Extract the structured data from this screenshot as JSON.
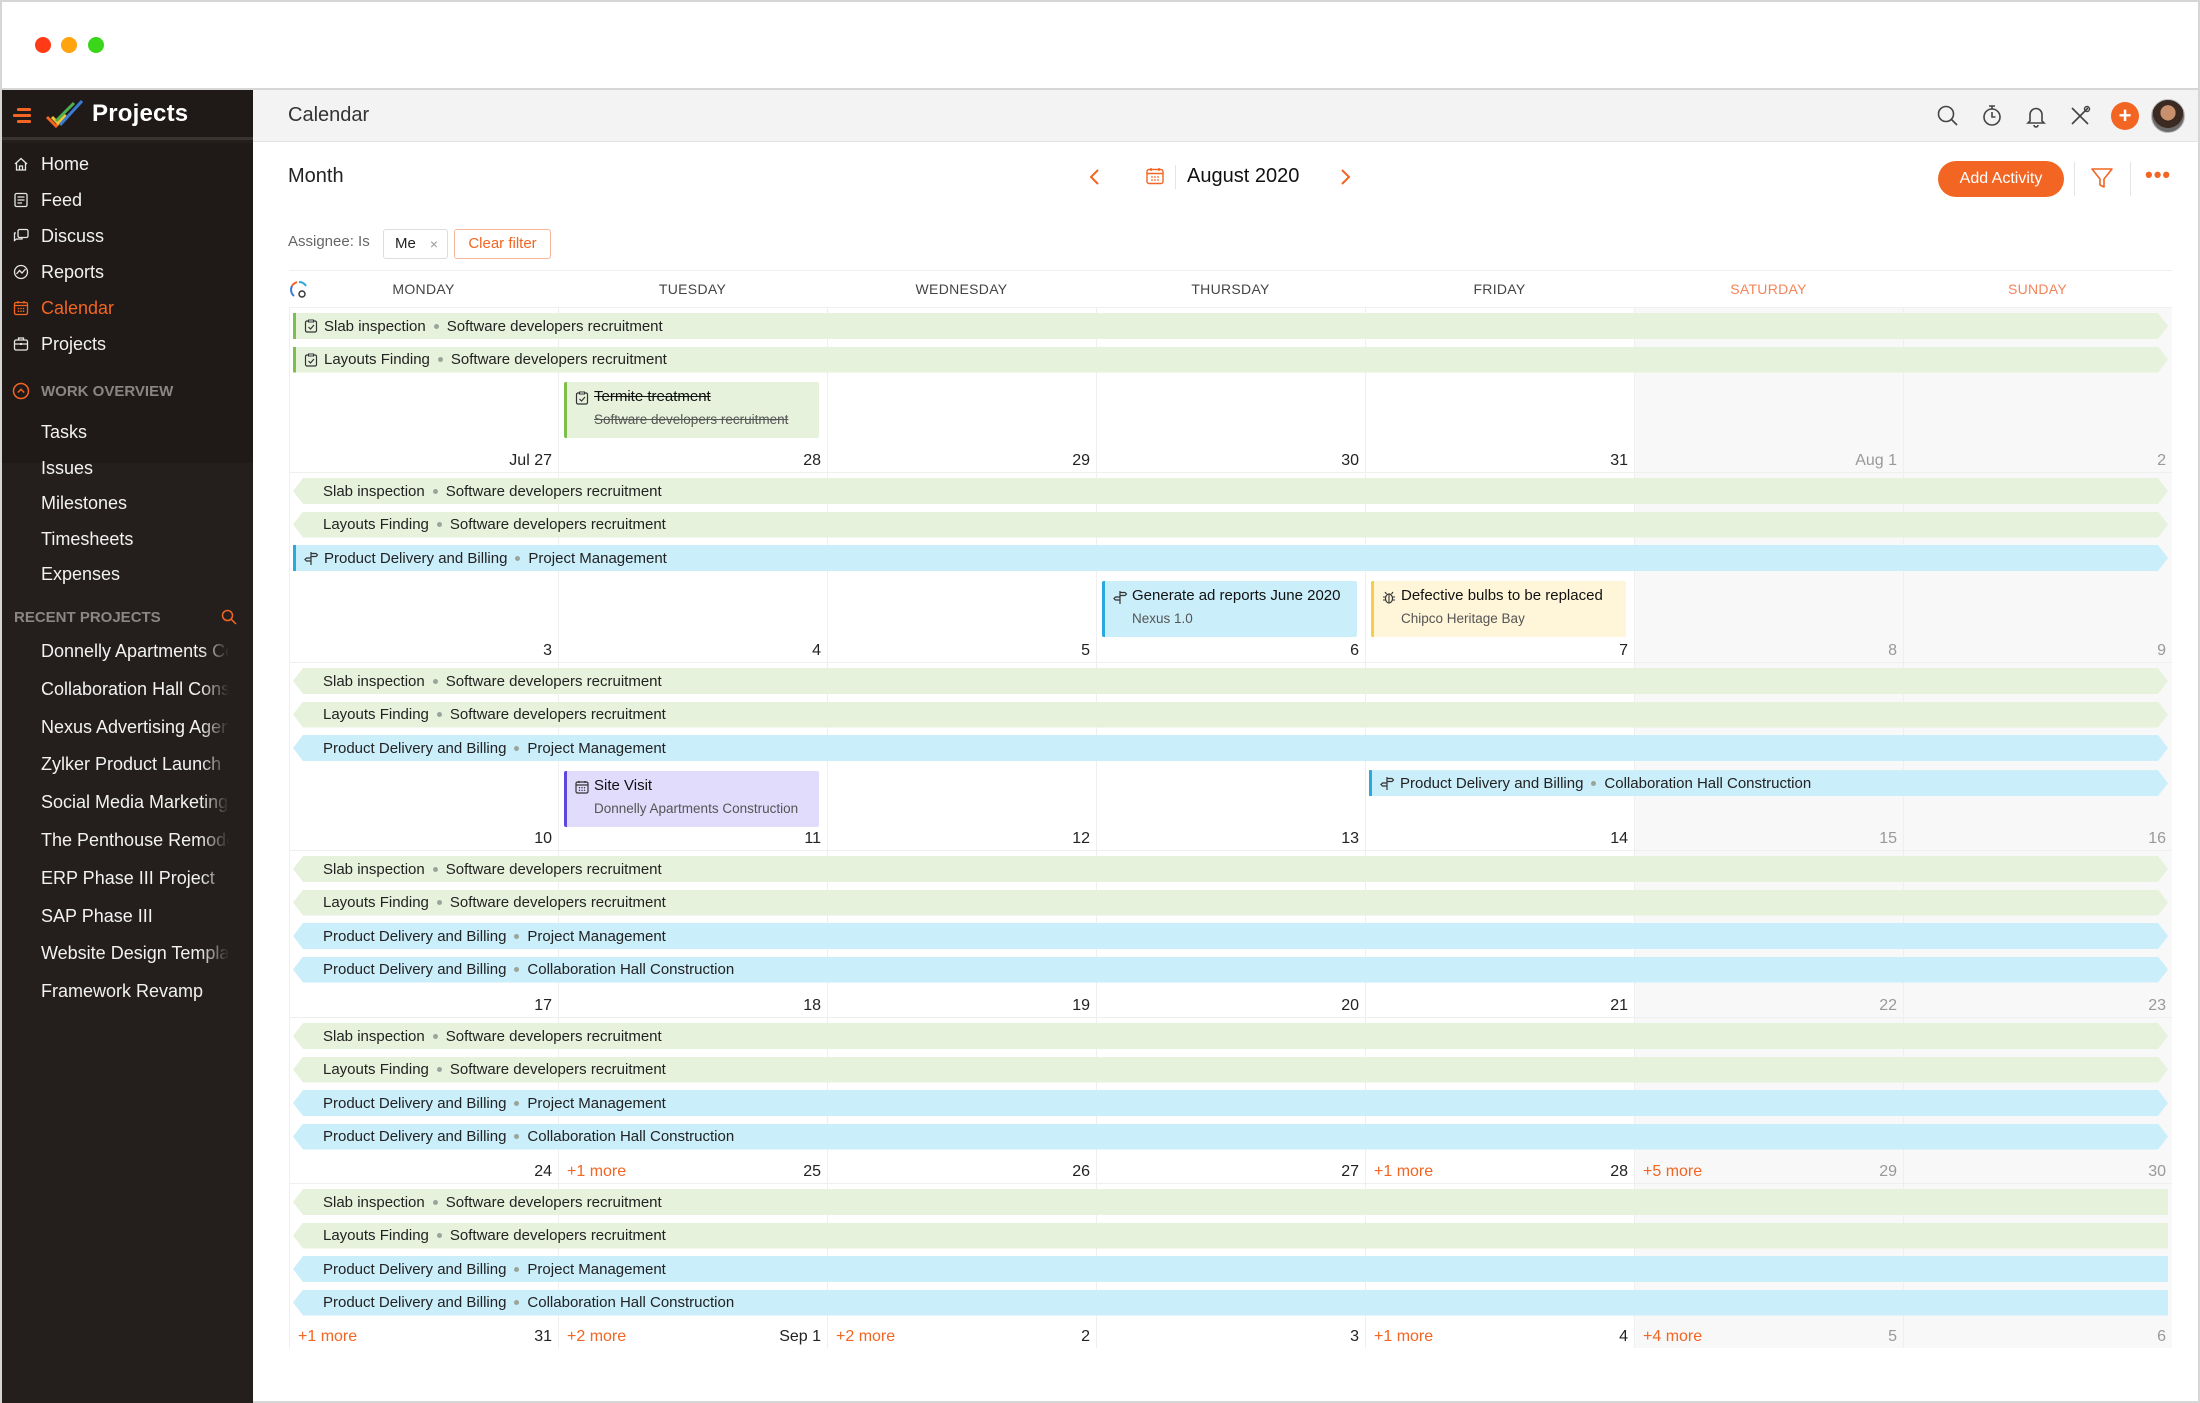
{
  "app": {
    "name": "Projects"
  },
  "sidebar": {
    "nav": [
      {
        "label": "Home",
        "icon": "home-icon",
        "active": false
      },
      {
        "label": "Feed",
        "icon": "feed-icon",
        "active": false
      },
      {
        "label": "Discuss",
        "icon": "discuss-icon",
        "active": false
      },
      {
        "label": "Reports",
        "icon": "reports-icon",
        "active": false
      },
      {
        "label": "Calendar",
        "icon": "calendar-icon",
        "active": true
      },
      {
        "label": "Projects",
        "icon": "briefcase-icon",
        "active": false
      }
    ],
    "work_overview": {
      "title": "WORK OVERVIEW",
      "items": [
        "Tasks",
        "Issues",
        "Milestones",
        "Timesheets",
        "Expenses"
      ]
    },
    "recent_projects": {
      "title": "RECENT PROJECTS",
      "items": [
        "Donnelly Apartments Construction",
        "Collaboration Hall Construction",
        "Nexus Advertising Agency",
        "Zylker Product Launch",
        "Social Media Marketing",
        "The Penthouse Remodel",
        "ERP Phase III Project",
        "SAP Phase III",
        "Website Design Template",
        "Framework Revamp"
      ]
    }
  },
  "topbar": {
    "title": "Calendar",
    "icons": [
      "search-icon",
      "timer-icon",
      "bell-icon",
      "tools-icon",
      "plus-icon",
      "avatar"
    ],
    "plus_label": "+"
  },
  "toolbar": {
    "view": "Month",
    "month_label": "August 2020",
    "add_activity": "Add Activity",
    "more": "•••"
  },
  "filter": {
    "label": "Assignee: Is",
    "chip": "Me",
    "chip_remove": "×",
    "clear": "Clear filter"
  },
  "colors": {
    "accent": "#f26522",
    "task_bg": "#e7f2dc",
    "task_border": "#7cc04b",
    "milestone_bg": "#cbeefb",
    "milestone_border": "#2aa8e0",
    "issue_bg": "#fff5d8",
    "issue_border": "#f7cd46",
    "event_bg": "#e1dcfb",
    "event_border": "#5b47e0",
    "sidebar_bg": "#241f1d"
  },
  "calendar": {
    "days": [
      {
        "name": "MONDAY",
        "weekend": false
      },
      {
        "name": "TUESDAY",
        "weekend": false
      },
      {
        "name": "WEDNESDAY",
        "weekend": false
      },
      {
        "name": "THURSDAY",
        "weekend": false
      },
      {
        "name": "FRIDAY",
        "weekend": false
      },
      {
        "name": "SATURDAY",
        "weekend": true
      },
      {
        "name": "SUNDAY",
        "weekend": true
      }
    ],
    "weeks": [
      {
        "dates": [
          "Jul 27",
          "28",
          "29",
          "30",
          "31",
          "Aug 1",
          "2"
        ],
        "dim": [
          false,
          false,
          false,
          false,
          false,
          true,
          true
        ],
        "more": [
          null,
          null,
          null,
          null,
          null,
          null,
          null
        ],
        "bars": [
          {
            "title": "Slab inspection",
            "project": "Software developers recruitment",
            "type": "task",
            "color": "green",
            "start": 0,
            "end": 6,
            "starts_here": true,
            "continues_right": true,
            "icon": "task-icon"
          },
          {
            "title": "Layouts Finding",
            "project": "Software developers recruitment",
            "type": "task",
            "color": "green",
            "start": 0,
            "end": 6,
            "starts_here": true,
            "continues_right": true,
            "icon": "task-icon"
          }
        ],
        "cards": [
          {
            "title": "Termite treatment",
            "subtitle": "Software developers recruitment",
            "type": "task",
            "color": "green",
            "col": 1,
            "done": true,
            "icon": "task-icon"
          }
        ]
      },
      {
        "dates": [
          "3",
          "4",
          "5",
          "6",
          "7",
          "8",
          "9"
        ],
        "dim": [
          false,
          false,
          false,
          false,
          false,
          true,
          true
        ],
        "more": [
          null,
          null,
          null,
          null,
          null,
          null,
          null
        ],
        "bars": [
          {
            "title": "Slab inspection",
            "project": "Software developers recruitment",
            "type": "task",
            "color": "green",
            "start": 0,
            "end": 6,
            "starts_here": false,
            "continues_right": true
          },
          {
            "title": "Layouts Finding",
            "project": "Software developers recruitment",
            "type": "task",
            "color": "green",
            "start": 0,
            "end": 6,
            "starts_here": false,
            "continues_right": true
          },
          {
            "title": "Product Delivery and Billing",
            "project": "Project Management",
            "type": "milestone",
            "color": "blue",
            "start": 0,
            "end": 6,
            "starts_here": true,
            "continues_right": true,
            "icon": "milestone-icon"
          }
        ],
        "cards": [
          {
            "title": "Generate ad reports June 2020",
            "subtitle": "Nexus 1.0",
            "type": "milestone",
            "color": "blue",
            "col": 3,
            "done": false,
            "icon": "milestone-icon"
          },
          {
            "title": "Defective bulbs to be replaced",
            "subtitle": "Chipco Heritage Bay",
            "type": "issue",
            "color": "yellow",
            "col": 4,
            "done": false,
            "icon": "bug-icon"
          }
        ]
      },
      {
        "dates": [
          "10",
          "11",
          "12",
          "13",
          "14",
          "15",
          "16"
        ],
        "dim": [
          false,
          false,
          false,
          false,
          false,
          true,
          true
        ],
        "more": [
          null,
          null,
          null,
          null,
          null,
          null,
          null
        ],
        "bars": [
          {
            "title": "Slab inspection",
            "project": "Software developers recruitment",
            "type": "task",
            "color": "green",
            "start": 0,
            "end": 6,
            "starts_here": false,
            "continues_right": true
          },
          {
            "title": "Layouts Finding",
            "project": "Software developers recruitment",
            "type": "task",
            "color": "green",
            "start": 0,
            "end": 6,
            "starts_here": false,
            "continues_right": true
          },
          {
            "title": "Product Delivery and Billing",
            "project": "Project Management",
            "type": "milestone",
            "color": "blue",
            "start": 0,
            "end": 6,
            "starts_here": false,
            "continues_right": true
          }
        ],
        "cards": [
          {
            "title": "Site Visit",
            "subtitle": "Donnelly Apartments Construction",
            "type": "event",
            "color": "purple",
            "col": 1,
            "done": false,
            "icon": "event-icon"
          }
        ],
        "row4_bars": [
          {
            "title": "Product Delivery and Billing",
            "project": "Collaboration Hall Construction",
            "type": "milestone",
            "color": "blue",
            "start": 4,
            "end": 6,
            "starts_here": true,
            "continues_right": true,
            "icon": "milestone-icon"
          }
        ]
      },
      {
        "dates": [
          "17",
          "18",
          "19",
          "20",
          "21",
          "22",
          "23"
        ],
        "dim": [
          false,
          false,
          false,
          false,
          false,
          true,
          true
        ],
        "more": [
          null,
          null,
          null,
          null,
          null,
          null,
          null
        ],
        "bars": [
          {
            "title": "Slab inspection",
            "project": "Software developers recruitment",
            "type": "task",
            "color": "green",
            "start": 0,
            "end": 6,
            "starts_here": false,
            "continues_right": true
          },
          {
            "title": "Layouts Finding",
            "project": "Software developers recruitment",
            "type": "task",
            "color": "green",
            "start": 0,
            "end": 6,
            "starts_here": false,
            "continues_right": true
          },
          {
            "title": "Product Delivery and Billing",
            "project": "Project Management",
            "type": "milestone",
            "color": "blue",
            "start": 0,
            "end": 6,
            "starts_here": false,
            "continues_right": true
          },
          {
            "title": "Product Delivery and Billing",
            "project": "Collaboration Hall Construction",
            "type": "milestone",
            "color": "blue",
            "start": 0,
            "end": 6,
            "starts_here": false,
            "continues_right": true
          }
        ],
        "cards": []
      },
      {
        "dates": [
          "24",
          "25",
          "26",
          "27",
          "28",
          "29",
          "30"
        ],
        "dim": [
          false,
          false,
          false,
          false,
          false,
          true,
          true
        ],
        "more": [
          "+1 more",
          null,
          null,
          "+1 more",
          "+5 more",
          null,
          null
        ],
        "bars": [
          {
            "title": "Slab inspection",
            "project": "Software developers recruitment",
            "type": "task",
            "color": "green",
            "start": 0,
            "end": 6,
            "starts_here": false,
            "continues_right": true
          },
          {
            "title": "Layouts Finding",
            "project": "Software developers recruitment",
            "type": "task",
            "color": "green",
            "start": 0,
            "end": 6,
            "starts_here": false,
            "continues_right": true
          },
          {
            "title": "Product Delivery and Billing",
            "project": "Project Management",
            "type": "milestone",
            "color": "blue",
            "start": 0,
            "end": 6,
            "starts_here": false,
            "continues_right": true
          },
          {
            "title": "Product Delivery and Billing",
            "project": "Collaboration Hall Construction",
            "type": "milestone",
            "color": "blue",
            "start": 0,
            "end": 6,
            "starts_here": false,
            "continues_right": true
          }
        ],
        "cards": []
      },
      {
        "dates": [
          "31",
          "Sep 1",
          "2",
          "3",
          "4",
          "5",
          "6"
        ],
        "dim": [
          false,
          false,
          false,
          false,
          false,
          true,
          true
        ],
        "more_prefix": [
          "+1 more",
          "+2 more",
          "+2 more",
          null,
          "+1 more",
          "+4 more",
          null
        ],
        "bars": [
          {
            "title": "Slab inspection",
            "project": "Software developers recruitment",
            "type": "task",
            "color": "green",
            "start": 0,
            "end": 6,
            "starts_here": false,
            "continues_right": false
          },
          {
            "title": "Layouts Finding",
            "project": "Software developers recruitment",
            "type": "task",
            "color": "green",
            "start": 0,
            "end": 6,
            "starts_here": false,
            "continues_right": false
          },
          {
            "title": "Product Delivery and Billing",
            "project": "Project Management",
            "type": "milestone",
            "color": "blue",
            "start": 0,
            "end": 6,
            "starts_here": false,
            "continues_right": false
          },
          {
            "title": "Product Delivery and Billing",
            "project": "Collaboration Hall Construction",
            "type": "milestone",
            "color": "blue",
            "start": 0,
            "end": 6,
            "starts_here": false,
            "continues_right": false
          }
        ],
        "cards": []
      }
    ]
  }
}
